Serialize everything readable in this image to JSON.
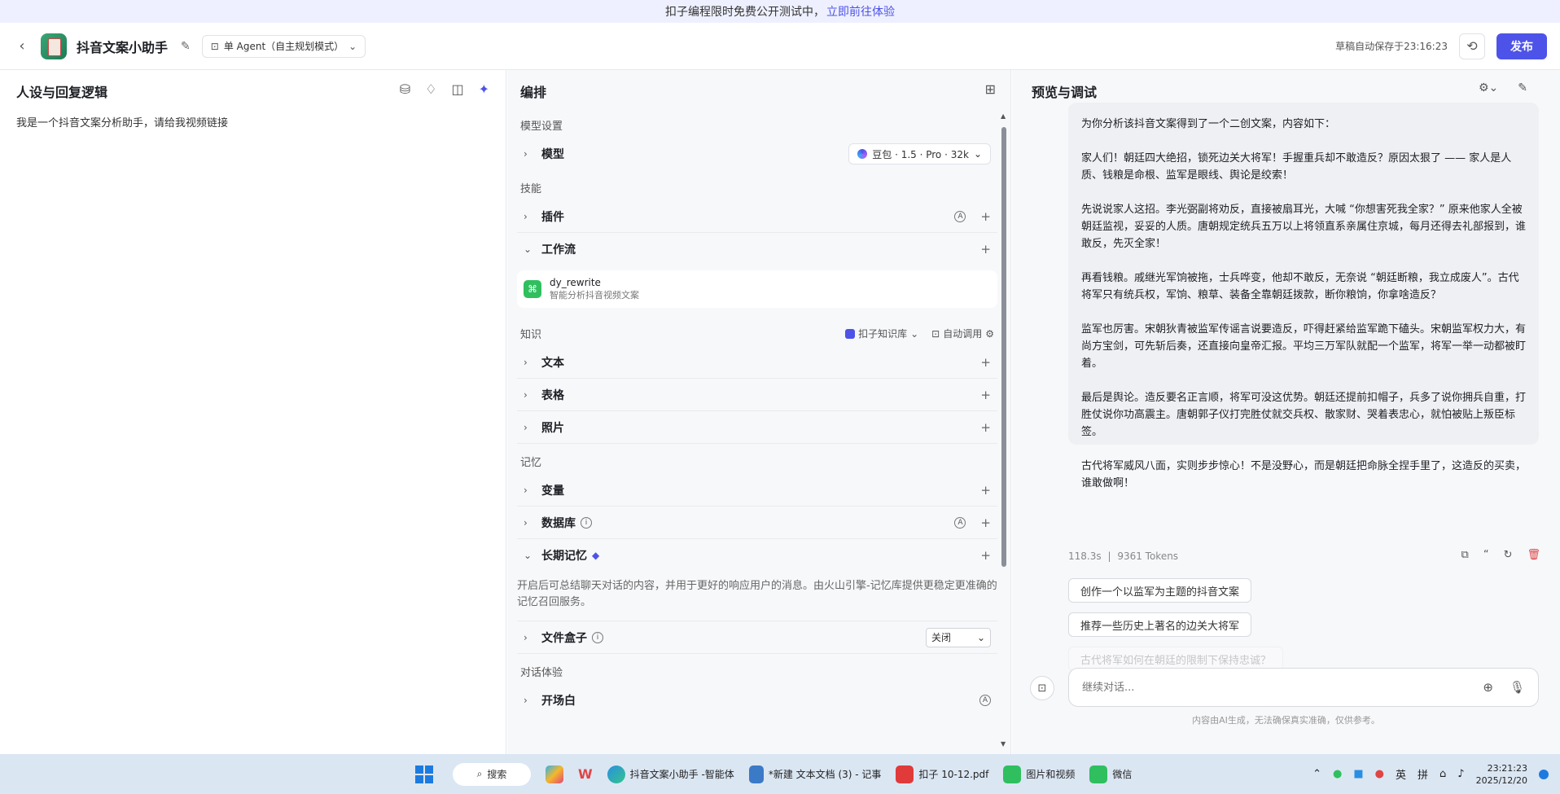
{
  "banner": {
    "text": "扣子编程限时免费公开测试中，",
    "link": "立即前往体验"
  },
  "header": {
    "bot_name": "抖音文案小助手",
    "mode": "单 Agent（自主规划模式）",
    "autosave": "草稿自动保存于23:16:23",
    "publish": "发布"
  },
  "left": {
    "title": "人设与回复逻辑",
    "persona": "我是一个抖音文案分析助手，请给我视频链接"
  },
  "mid": {
    "title": "编排",
    "model_section": "模型设置",
    "model_label": "模型",
    "model_value": "豆包 · 1.5 · Pro · 32k",
    "skills_section": "技能",
    "plugin": "插件",
    "workflow": "工作流",
    "wf_name": "dy_rewrite",
    "wf_desc": "智能分析抖音视频文案",
    "knowledge_section": "知识",
    "kb_name": "扣子知识库",
    "auto_call": "自动调用",
    "text": "文本",
    "table": "表格",
    "photo": "照片",
    "memory_section": "记忆",
    "variable": "变量",
    "database": "数据库",
    "longterm": "长期记忆",
    "longterm_desc": "开启后可总结聊天对话的内容，并用于更好的响应用户的消息。由火山引擎-记忆库提供更稳定更准确的记忆召回服务。",
    "filebox": "文件盒子",
    "filebox_value": "关闭",
    "dialog_section": "对话体验",
    "opening": "开场白"
  },
  "right": {
    "title": "预览与调试",
    "message": [
      "为你分析该抖音文案得到了一个二创文案，内容如下：",
      "家人们！朝廷四大绝招，锁死边关大将军！手握重兵却不敢造反？原因太狠了 —— 家人是人质、钱粮是命根、监军是眼线、舆论是绞索！",
      "先说说家人这招。李光弼副将劝反，直接被扇耳光，大喊 “你想害死我全家？” 原来他家人全被朝廷监视，妥妥的人质。唐朝规定统兵五万以上将领直系亲属住京城，每月还得去礼部报到，谁敢反，先灭全家！",
      "再看钱粮。戚继光军饷被拖，士兵哗变，他却不敢反，无奈说 “朝廷断粮，我立成废人”。古代将军只有统兵权，军饷、粮草、装备全靠朝廷拨款，断你粮饷，你拿啥造反？",
      "监军也厉害。宋朝狄青被监军传谣言说要造反，吓得赶紧给监军跪下磕头。宋朝监军权力大，有尚方宝剑，可先斩后奏，还直接向皇帝汇报。平均三万军队就配一个监军，将军一举一动都被盯着。",
      "最后是舆论。造反要名正言顺，将军可没这优势。朝廷还提前扣帽子，兵多了说你拥兵自重，打胜仗说你功高震主。唐朝郭子仪打完胜仗就交兵权、散家财、哭着表忠心，就怕被贴上叛臣标签。",
      "古代将军威风八面，实则步步惊心！不是没野心，而是朝廷把命脉全捏手里了，这造反的买卖，谁敢做啊！"
    ],
    "duration": "118.3s",
    "tokens": "9361 Tokens",
    "suggestions": [
      "创作一个以监军为主题的抖音文案",
      "推荐一些历史上著名的边关大将军",
      "古代将军如何在朝廷的限制下保持忠诚？"
    ],
    "input_placeholder": "继续对话...",
    "disclaimer": "内容由AI生成，无法确保真实准确，仅供参考。"
  },
  "taskbar": {
    "search": "搜索",
    "apps": [
      "抖音文案小助手 -智能体",
      "*新建 文本文档 (3) - 记事",
      "扣子 10-12.pdf",
      "图片和视频",
      "微信"
    ],
    "ime1": "英",
    "ime2": "拼",
    "time": "23:21:23",
    "date": "2025/12/20"
  }
}
